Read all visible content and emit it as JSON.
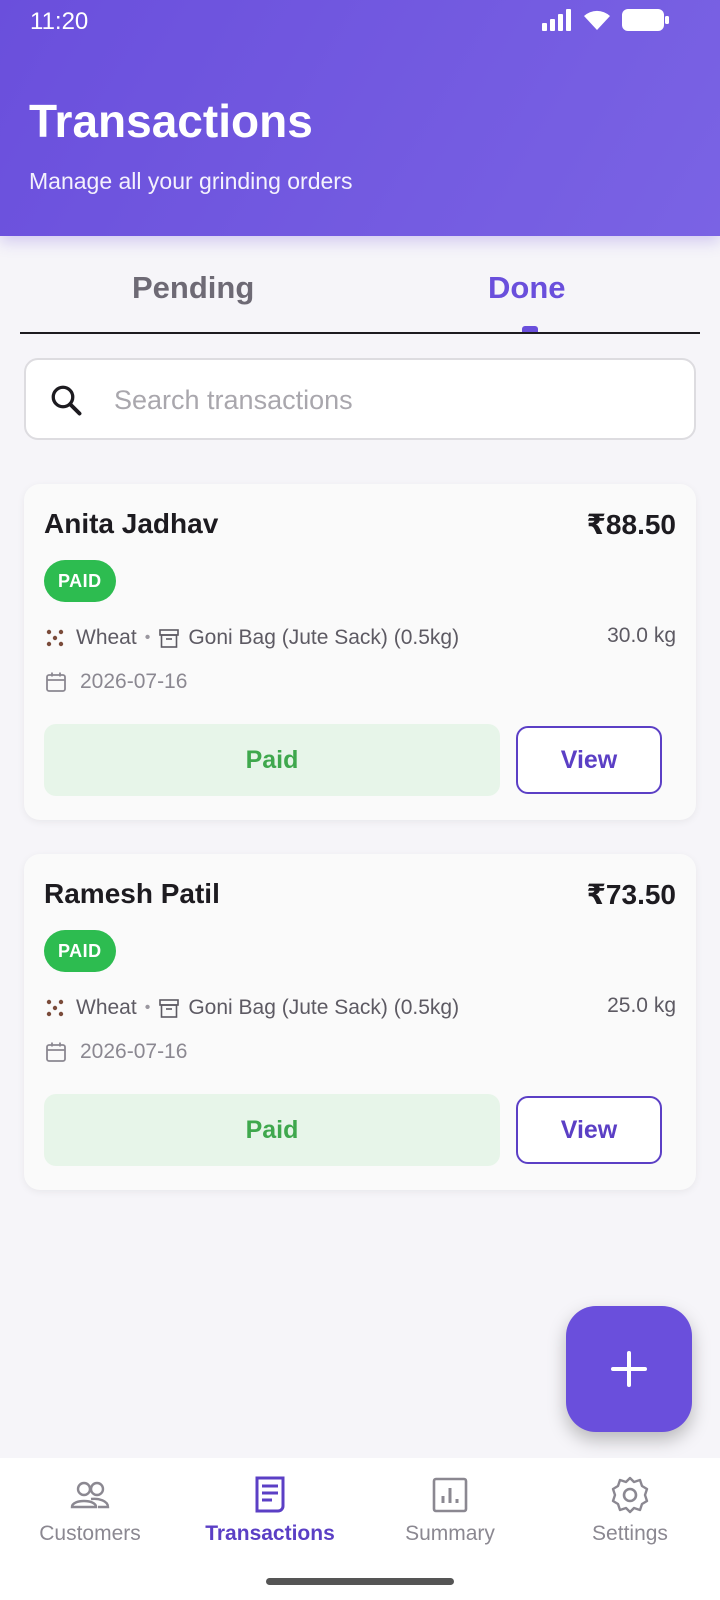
{
  "status_bar": {
    "time": "11:20"
  },
  "header": {
    "title": "Transactions",
    "subtitle": "Manage all your grinding orders"
  },
  "tabs": [
    {
      "label": "Pending",
      "active": false
    },
    {
      "label": "Done",
      "active": true
    }
  ],
  "search": {
    "placeholder": "Search transactions",
    "value": ""
  },
  "transactions": [
    {
      "customer": "Anita Jadhav",
      "amount": "₹88.50",
      "status_badge": "PAID",
      "grain": "Wheat",
      "container": "Goni Bag (Jute Sack) (0.5kg)",
      "weight": "30.0 kg",
      "date": "2026-07-16",
      "paid_label": "Paid",
      "view_label": "View"
    },
    {
      "customer": "Ramesh Patil",
      "amount": "₹73.50",
      "status_badge": "PAID",
      "grain": "Wheat",
      "container": "Goni Bag (Jute Sack) (0.5kg)",
      "weight": "25.0 kg",
      "date": "2026-07-16",
      "paid_label": "Paid",
      "view_label": "View"
    }
  ],
  "fab": {
    "icon": "plus-icon"
  },
  "bottom_nav": [
    {
      "label": "Customers",
      "icon": "people-icon",
      "active": false
    },
    {
      "label": "Transactions",
      "icon": "receipt-icon",
      "active": true
    },
    {
      "label": "Summary",
      "icon": "chart-icon",
      "active": false
    },
    {
      "label": "Settings",
      "icon": "gear-icon",
      "active": false
    }
  ],
  "colors": {
    "primary": "#6a4fdc",
    "paid_badge": "#2dbc50",
    "paid_button_bg": "#e7f5e9",
    "paid_button_text": "#3fa84d"
  }
}
